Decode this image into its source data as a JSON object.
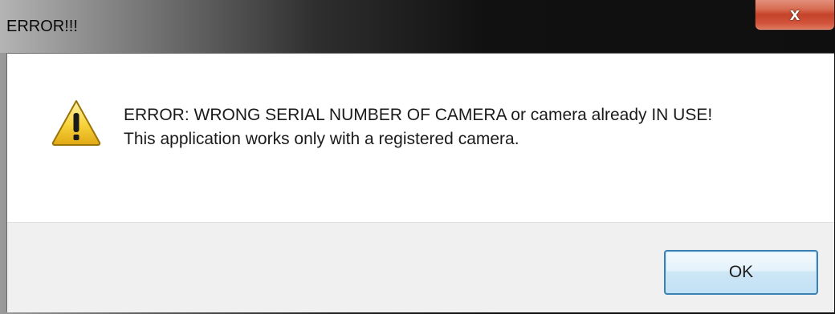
{
  "window": {
    "title": "ERROR!!!",
    "close_label": "x"
  },
  "dialog": {
    "icon": "warning-icon",
    "message_line1": "ERROR: WRONG SERIAL NUMBER OF CAMERA or camera already IN USE!",
    "message_line2": "This application works only with a registered camera.",
    "ok_label": "OK"
  },
  "colors": {
    "close_button": "#c4432a",
    "ok_button_border": "#3c7fb1",
    "button_area_bg": "#f0f0f0",
    "warning_yellow": "#f5c518"
  }
}
